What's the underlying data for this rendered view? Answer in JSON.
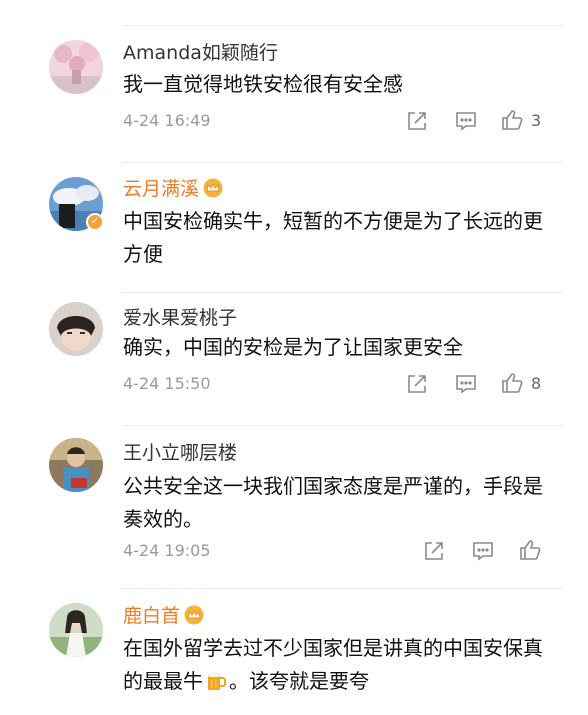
{
  "comments": [
    {
      "user": "Amanda如颖随行",
      "text": "我一直觉得地铁安检很有安全感",
      "time": "4-24 16:49",
      "likes": "3"
    },
    {
      "user": "云月满溪",
      "text": "中国安检确实牛，短暂的不方便是为了长远的更方便",
      "verified": "✓"
    },
    {
      "user": "爱水果爱桃子",
      "text": "确实，中国的安检是为了让国家更安全",
      "time": "4-24 15:50",
      "likes": "8"
    },
    {
      "user": "王小立哪层楼",
      "text": "公共安全这一块我们国家态度是严谨的，手段是奏效的。",
      "time": "4-24 19:05"
    },
    {
      "user": "鹿白首",
      "text_before": "在国外留学去过不少国家但是讲真的中国安保真的最最牛",
      "text_after": "。该夸就是要夸"
    }
  ],
  "colors": {
    "vip_name": "#f47b22",
    "name": "#333333",
    "meta": "#9a9a9a"
  },
  "icons": [
    "share-icon",
    "comment-icon",
    "like-icon",
    "crown-icon",
    "beer-emoji-icon"
  ]
}
